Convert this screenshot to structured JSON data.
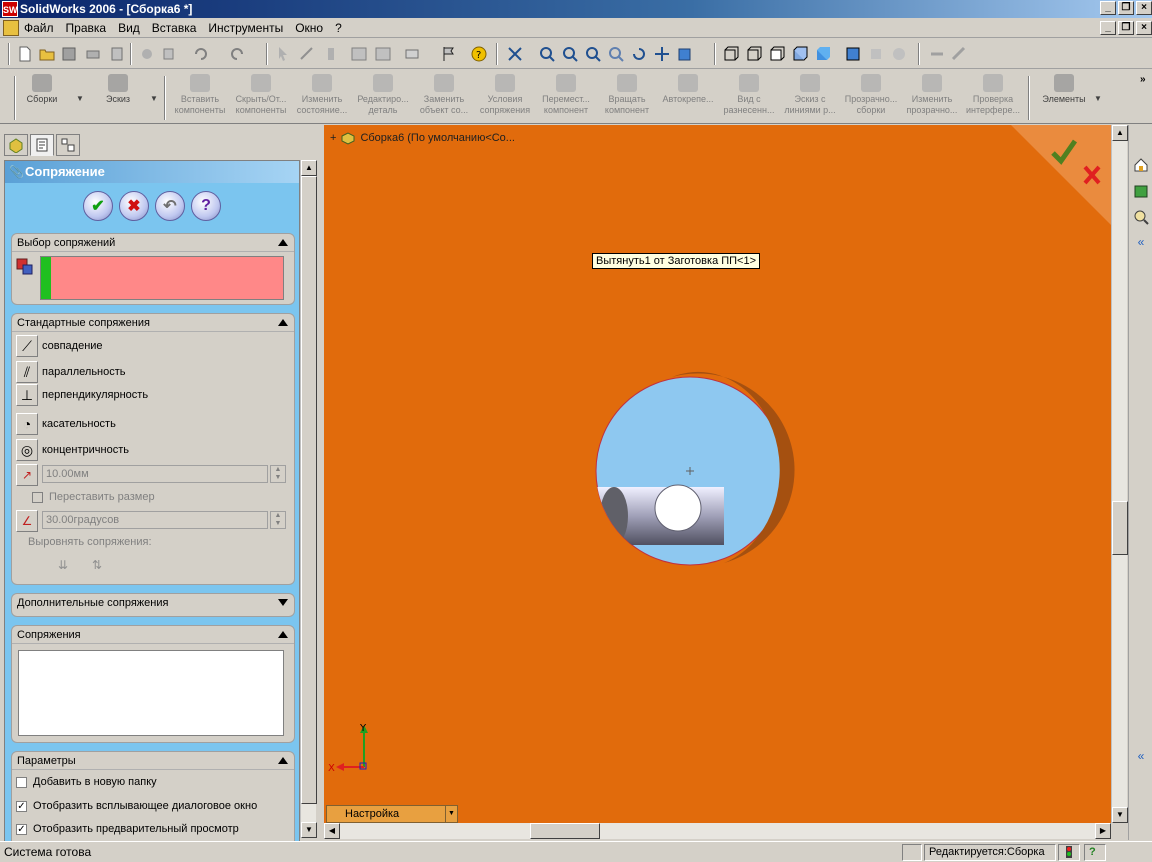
{
  "window": {
    "title": "SolidWorks 2006 - [Сборка6 *]",
    "logo_text": "SW"
  },
  "menu": [
    "Файл",
    "Правка",
    "Вид",
    "Вставка",
    "Инструменты",
    "Окно",
    "?"
  ],
  "command_manager": {
    "groups": [
      {
        "label": "Сборки",
        "dropdown": true
      },
      {
        "label": "Эскиз",
        "dropdown": true
      }
    ],
    "commands": [
      {
        "line1": "Вставить",
        "line2": "компоненты"
      },
      {
        "line1": "Скрыть/От...",
        "line2": "компоненты"
      },
      {
        "line1": "Изменить",
        "line2": "состояние..."
      },
      {
        "line1": "Редактиро...",
        "line2": "деталь"
      },
      {
        "line1": "Заменить",
        "line2": "объект со..."
      },
      {
        "line1": "Условия",
        "line2": "сопряжения"
      },
      {
        "line1": "Перемест...",
        "line2": "компонент"
      },
      {
        "line1": "Вращать",
        "line2": "компонент"
      },
      {
        "line1": "Автокрепе...",
        "line2": ""
      },
      {
        "line1": "Вид с",
        "line2": "разнесенн..."
      },
      {
        "line1": "Эскиз с",
        "line2": "линиями р..."
      },
      {
        "line1": "Прозрачно...",
        "line2": "сборки"
      },
      {
        "line1": "Изменить",
        "line2": "прозрачно..."
      },
      {
        "line1": "Проверка",
        "line2": "интерфере..."
      }
    ],
    "elements_label": "Элементы"
  },
  "property_manager": {
    "title": "Сопряжение",
    "mate_selection": {
      "header": "Выбор сопряжений"
    },
    "standard_mates": {
      "header": "Стандартные сопряжения",
      "items": [
        {
          "label": "совпадение",
          "icon": "coincident-icon"
        },
        {
          "label": "параллельность",
          "icon": "parallel-icon"
        },
        {
          "label": "перпендикулярность",
          "icon": "perpendicular-icon"
        },
        {
          "label": "касательность",
          "icon": "tangent-icon"
        },
        {
          "label": "концентричность",
          "icon": "concentric-icon"
        }
      ],
      "distance_value": "10.00мм",
      "flip_dimension": "Переставить размер",
      "angle_value": "30.00градусов",
      "align_label": "Выровнять сопряжения:"
    },
    "advanced_mates": {
      "header": "Дополнительные сопряжения"
    },
    "mates": {
      "header": "Сопряжения"
    },
    "options": {
      "header": "Параметры",
      "add_to_folder": "Добавить в новую папку",
      "show_popup": "Отобразить всплывающее диалоговое окно",
      "show_preview": "Отобразить предварительный просмотр"
    }
  },
  "viewport": {
    "tree_root": "Сборка6  (По умолчанию<Со...",
    "tooltip": "Вытянуть1 от Заготовка ПП<1>",
    "configuration": "Настройка",
    "axis_x": "X",
    "axis_y": "Y",
    "colors": {
      "background": "#e16b0c",
      "hole": "#8ec8f0"
    }
  },
  "status": {
    "text": "Система готова",
    "editing": "Редактируется:Сборка"
  }
}
